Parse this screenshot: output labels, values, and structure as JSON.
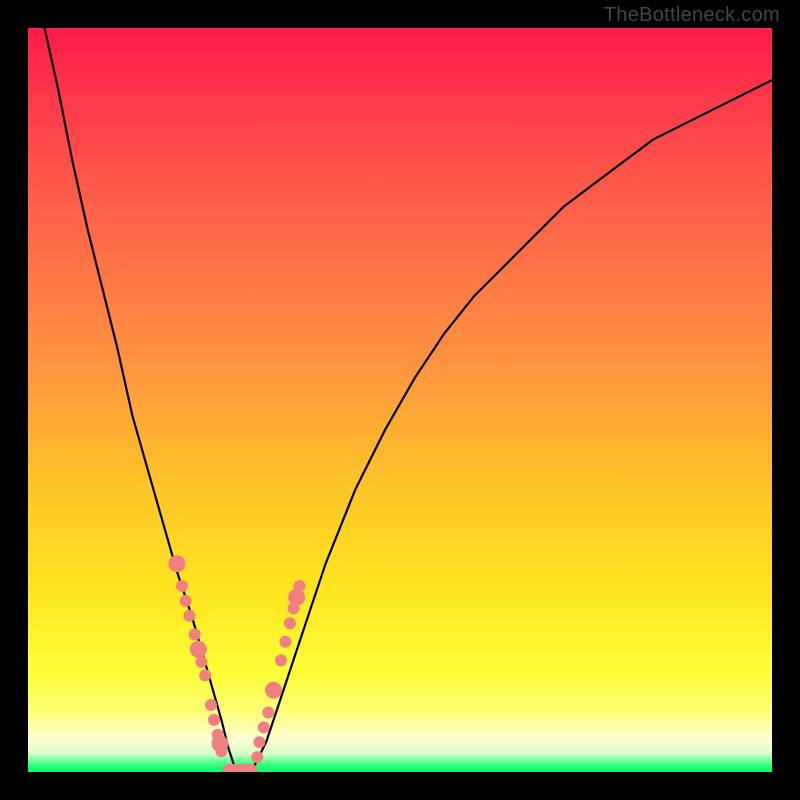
{
  "watermark": {
    "text": "TheBottleneck.com"
  },
  "colors": {
    "curve": "#000000",
    "dots": "#f28080",
    "gradient_top": "#ff1a4a",
    "gradient_bottom": "#00ff70"
  },
  "chart_data": {
    "type": "line",
    "title": "",
    "xlabel": "",
    "ylabel": "",
    "xlim": [
      0,
      100
    ],
    "ylim": [
      0,
      100
    ],
    "grid": false,
    "legend": false,
    "x": [
      0,
      2,
      4,
      6,
      8,
      10,
      12,
      14,
      16,
      18,
      20,
      22,
      24,
      26,
      27,
      28,
      30,
      32,
      34,
      36,
      38,
      40,
      44,
      48,
      52,
      56,
      60,
      64,
      68,
      72,
      76,
      80,
      84,
      88,
      92,
      96,
      100
    ],
    "y": [
      110,
      101,
      92,
      82,
      73,
      65,
      57,
      48,
      41,
      34,
      27,
      21,
      14,
      7,
      3,
      0,
      0,
      4,
      10,
      16,
      22,
      28,
      38,
      46,
      53,
      59,
      64,
      68,
      72,
      76,
      79,
      82,
      85,
      87,
      89,
      91,
      93
    ],
    "series_note": "V-shaped bottleneck curve; floor near x≈27; right branch asymptotically rises",
    "dots": {
      "note": "approximate marker positions (x,y) along the curve near the trough",
      "points": [
        [
          20.0,
          28.0
        ],
        [
          20.7,
          25.0
        ],
        [
          21.2,
          23.0
        ],
        [
          21.7,
          21.0
        ],
        [
          22.4,
          18.5
        ],
        [
          22.9,
          16.5
        ],
        [
          23.3,
          14.8
        ],
        [
          23.8,
          13.0
        ],
        [
          24.6,
          9.0
        ],
        [
          25.0,
          7.0
        ],
        [
          25.5,
          5.0
        ],
        [
          25.8,
          3.8
        ],
        [
          26.0,
          2.8
        ],
        [
          27.0,
          0.3
        ],
        [
          27.8,
          0.3
        ],
        [
          28.6,
          0.3
        ],
        [
          29.3,
          0.3
        ],
        [
          30.0,
          0.3
        ],
        [
          30.8,
          2.0
        ],
        [
          31.1,
          4.0
        ],
        [
          31.7,
          6.0
        ],
        [
          32.3,
          8.0
        ],
        [
          33.0,
          11.0
        ],
        [
          34.0,
          15.0
        ],
        [
          34.6,
          17.5
        ],
        [
          35.2,
          20.0
        ],
        [
          35.7,
          22.0
        ],
        [
          36.1,
          23.5
        ],
        [
          36.5,
          25.0
        ]
      ]
    }
  }
}
